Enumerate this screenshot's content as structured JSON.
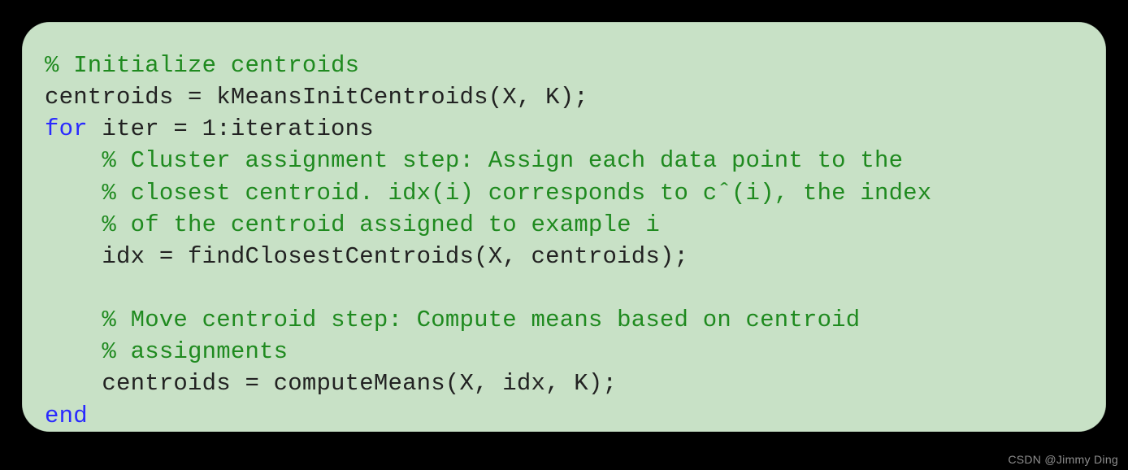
{
  "code": {
    "lines": [
      {
        "type": "comment",
        "text": "% Initialize centroids"
      },
      {
        "type": "code",
        "text": "centroids = kMeansInitCentroids(X, K);"
      },
      {
        "type": "for",
        "keyword": "for",
        "rest": " iter = 1:iterations"
      },
      {
        "type": "comment",
        "indent": "    ",
        "text": "% Cluster assignment step: Assign each data point to the"
      },
      {
        "type": "comment",
        "indent": "    ",
        "text": "% closest centroid. idx(i) corresponds to cˆ(i), the index"
      },
      {
        "type": "comment",
        "indent": "    ",
        "text": "% of the centroid assigned to example i"
      },
      {
        "type": "code",
        "indent": "    ",
        "text": "idx = findClosestCentroids(X, centroids);"
      },
      {
        "type": "blank",
        "text": ""
      },
      {
        "type": "comment",
        "indent": "    ",
        "text": "% Move centroid step: Compute means based on centroid"
      },
      {
        "type": "comment",
        "indent": "    ",
        "text": "% assignments"
      },
      {
        "type": "code",
        "indent": "    ",
        "text": "centroids = computeMeans(X, idx, K);"
      },
      {
        "type": "end",
        "keyword": "end"
      }
    ]
  },
  "watermark": "CSDN @Jimmy Ding"
}
